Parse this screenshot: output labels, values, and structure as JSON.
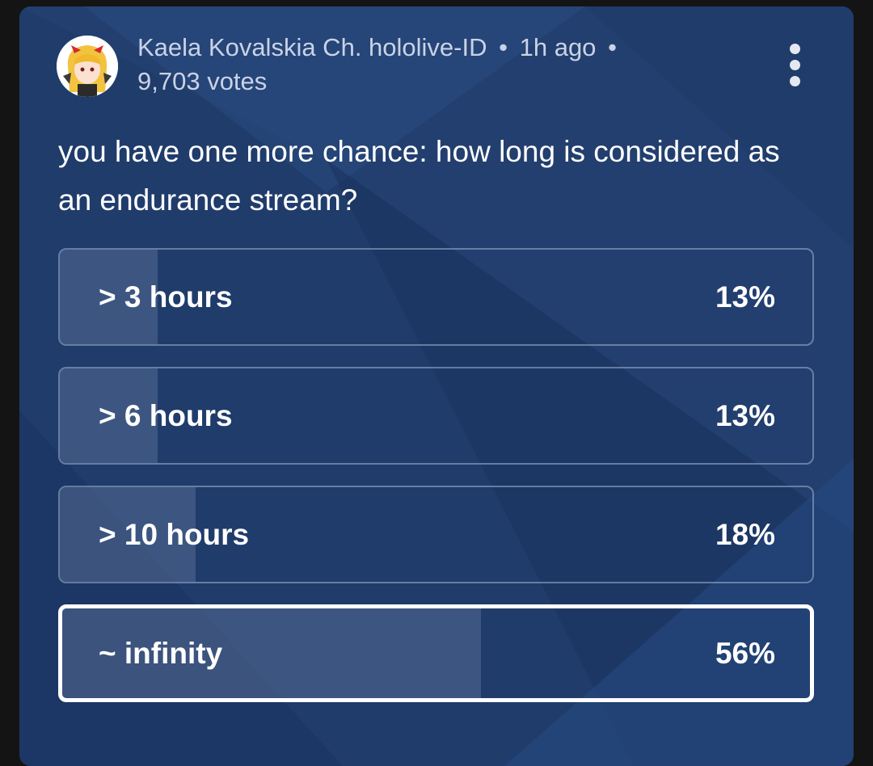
{
  "post": {
    "channel_name": "Kaela Kovalskia Ch. hololive-ID",
    "separator": "•",
    "time_ago": "1h ago",
    "votes": "9,703 votes",
    "question": "you have one more chance: how long is considered as an endurance stream?"
  },
  "poll": {
    "options": [
      {
        "label": "> 3 hours",
        "percent": "13%",
        "fill_fraction": 0.13,
        "selected": false
      },
      {
        "label": "> 6 hours",
        "percent": "13%",
        "fill_fraction": 0.13,
        "selected": false
      },
      {
        "label": "> 10 hours",
        "percent": "18%",
        "fill_fraction": 0.18,
        "selected": false
      },
      {
        "label": "~ infinity",
        "percent": "56%",
        "fill_fraction": 0.56,
        "selected": true
      }
    ]
  },
  "icons": {
    "avatar": "channel-avatar",
    "menu": "more-vert-icon"
  },
  "colors": {
    "card_background": "#1e3b6a",
    "page_background": "#141414",
    "text_primary": "#ffffff",
    "text_secondary": "#c9d3e6",
    "selected_border": "#ffffff"
  }
}
